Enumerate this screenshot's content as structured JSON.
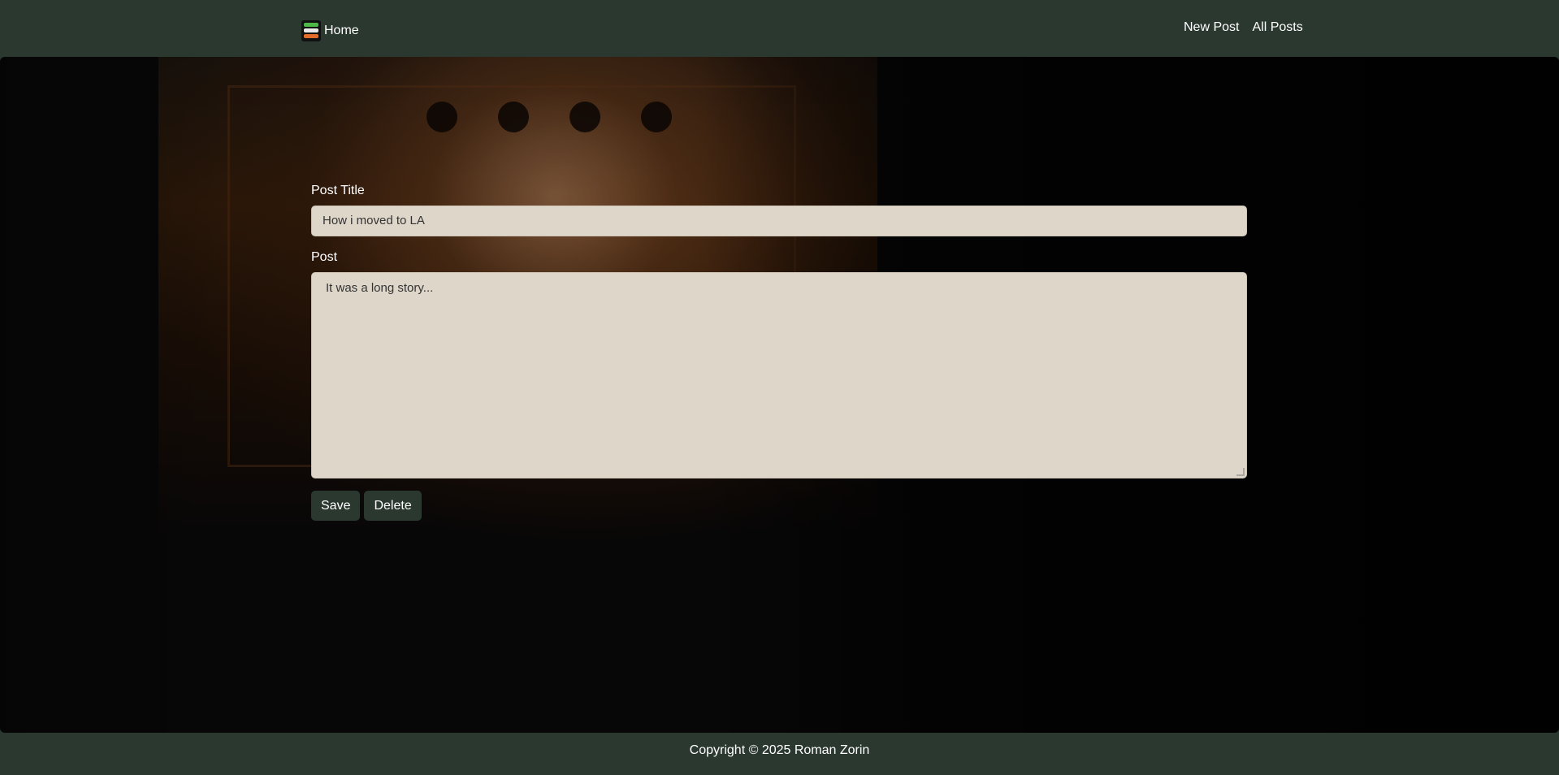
{
  "navbar": {
    "brand_label": "Home",
    "links": [
      "New Post",
      "All Posts"
    ]
  },
  "form": {
    "title_label": "Post Title",
    "title_value": "How i moved to LA",
    "post_label": "Post",
    "post_value": "It was a long story...",
    "save_label": "Save",
    "delete_label": "Delete"
  },
  "footer": {
    "copyright": "Copyright © 2025 Roman Zorin"
  },
  "colors": {
    "navbar_bg": "#2b3830",
    "input_bg": "#ded6c9",
    "button_bg": "#2b3830"
  }
}
